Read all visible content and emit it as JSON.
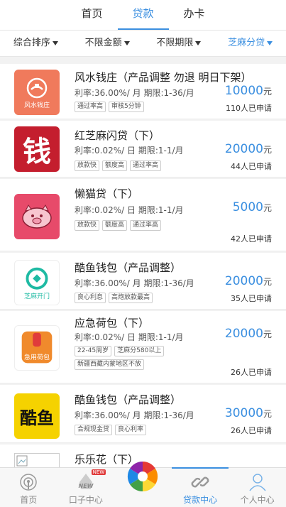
{
  "top_tabs": [
    {
      "label": "首页"
    },
    {
      "label": "贷款"
    },
    {
      "label": "办卡"
    }
  ],
  "filters": [
    {
      "label": "综合排序"
    },
    {
      "label": "不限金额"
    },
    {
      "label": "不限期限"
    },
    {
      "label": "芝麻分贷"
    }
  ],
  "loans": [
    {
      "title": "风水钱庄（产品调整 勿退 明日下架）",
      "rate": "利率:36.00%/ 月 期限:1-36/月",
      "amount": "10000",
      "unit": "元",
      "applicants": "110人已申请",
      "tags": [
        "通过率高",
        "审核5分钟"
      ],
      "logo_text": "风水钱庄",
      "logo_icon": "fengshui-logo-icon"
    },
    {
      "title": "红芝麻闪贷（下）",
      "rate": "利率:0.02%/ 日 期限:1-1/月",
      "amount": "20000",
      "unit": "元",
      "applicants": "44人已申请",
      "tags": [
        "放款快",
        "额度高",
        "通过率高"
      ],
      "logo_text": "钱",
      "logo_icon": "qian-logo-icon"
    },
    {
      "title": "懒猫贷（下）",
      "rate": "利率:0.02%/ 日 期限:1-1/月",
      "amount": "5000",
      "unit": "元",
      "applicants": "42人已申请",
      "tags": [
        "放款快",
        "额度高",
        "通过率高"
      ],
      "logo_text": "",
      "logo_icon": "piggy-logo-icon"
    },
    {
      "title": "酷鱼钱包（产品调整）",
      "rate": "利率:36.00%/ 月 期限:1-36/月",
      "amount": "20000",
      "unit": "元",
      "applicants": "35人已申请",
      "tags": [
        "良心利息",
        "高炮放款最高"
      ],
      "logo_text": "芝麻开门",
      "logo_icon": "zhima-logo-icon"
    },
    {
      "title": "应急荷包（下）",
      "rate": "利率:0.02%/ 日 期限:1-1/月",
      "amount": "20000",
      "unit": "元",
      "applicants": "26人已申请",
      "tags": [
        "22-45周岁",
        "芝麻分580以上",
        "新疆西藏内蒙地区不放"
      ],
      "logo_text": "急用荷包",
      "logo_icon": "wallet-logo-icon"
    },
    {
      "title": "酷鱼钱包（产品调整）",
      "rate": "利率:36.00%/ 月 期限:1-36/月",
      "amount": "30000",
      "unit": "元",
      "applicants": "26人已申请",
      "tags": [
        "合规现金贷",
        "良心利率"
      ],
      "logo_text": "酷鱼",
      "logo_icon": "kuyu-logo-icon"
    },
    {
      "title": "乐乐花（下）",
      "rate": "",
      "amount": "",
      "unit": "",
      "applicants": "",
      "tags": [],
      "logo_text": "",
      "logo_icon": "broken-image-icon"
    }
  ],
  "bottom_nav": [
    {
      "label": "首页",
      "icon": "home-signal-icon"
    },
    {
      "label": "口子中心",
      "icon": "new-icon",
      "badge": "NEW"
    },
    {
      "label": "",
      "icon": "aperture-icon"
    },
    {
      "label": "贷款中心",
      "icon": "link-icon"
    },
    {
      "label": "个人中心",
      "icon": "user-icon"
    }
  ],
  "colors": {
    "accent": "#3b8fe0"
  }
}
